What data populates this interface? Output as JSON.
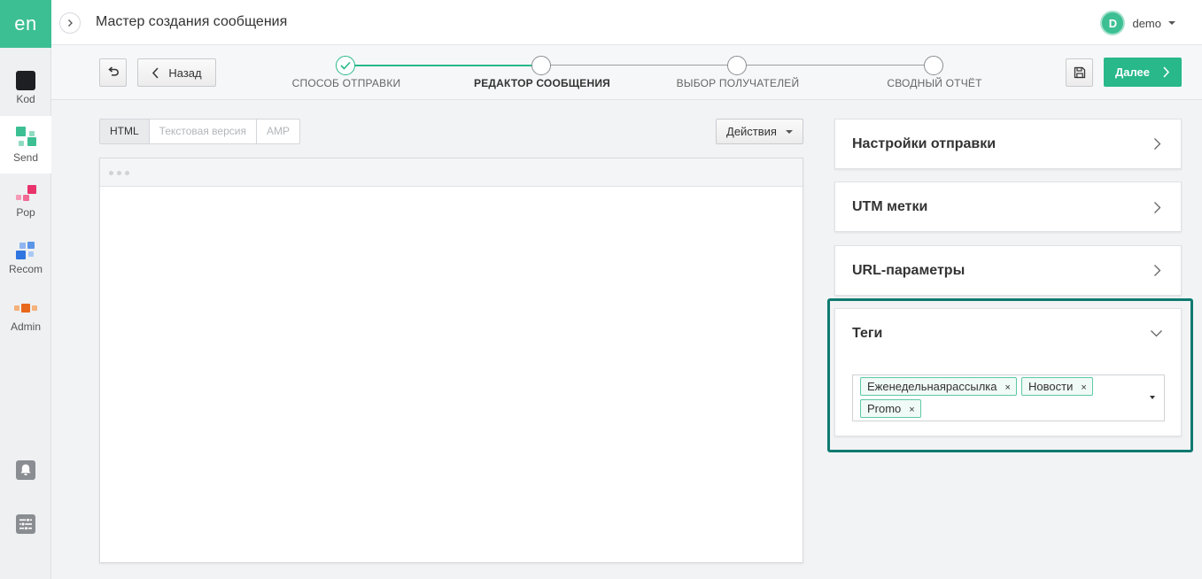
{
  "app": {
    "logo": "en",
    "title": "Мастер создания сообщения"
  },
  "user": {
    "initial": "D",
    "name": "demo"
  },
  "sidebar": {
    "items": [
      {
        "label": "Kod",
        "icon": "kod-icon"
      },
      {
        "label": "Send",
        "icon": "send-icon"
      },
      {
        "label": "Pop",
        "icon": "pop-icon"
      },
      {
        "label": "Recom",
        "icon": "recom-icon"
      },
      {
        "label": "Admin",
        "icon": "admin-icon"
      }
    ],
    "bottom_icons": [
      "bell-icon",
      "settings-sliders-icon"
    ]
  },
  "wizard": {
    "back_label": "Назад",
    "next_label": "Далее",
    "steps": [
      {
        "label": "СПОСОБ ОТПРАВКИ",
        "status": "done"
      },
      {
        "label": "РЕДАКТОР СООБЩЕНИЯ",
        "status": "current"
      },
      {
        "label": "ВЫБОР ПОЛУЧАТЕЛЕЙ",
        "status": "pending"
      },
      {
        "label": "СВОДНЫЙ ОТЧЁТ",
        "status": "pending"
      }
    ]
  },
  "editor": {
    "tabs": [
      {
        "label": "HTML",
        "active": true
      },
      {
        "label": "Текстовая версия",
        "active": false
      },
      {
        "label": "AMP",
        "active": false
      }
    ],
    "actions_label": "Действия"
  },
  "panels": {
    "send_settings": "Настройки отправки",
    "utm": "UTM метки",
    "url_params": "URL-параметры",
    "tags": {
      "title": "Теги",
      "values": [
        "Еженедельнаярассылка",
        "Новости",
        "Promo"
      ],
      "remove_glyph": "×"
    }
  },
  "colors": {
    "brand": "#3dbf94",
    "primary_button": "#28b889",
    "highlight_border": "#0f7a70",
    "tag_border": "#5fc9a3"
  }
}
